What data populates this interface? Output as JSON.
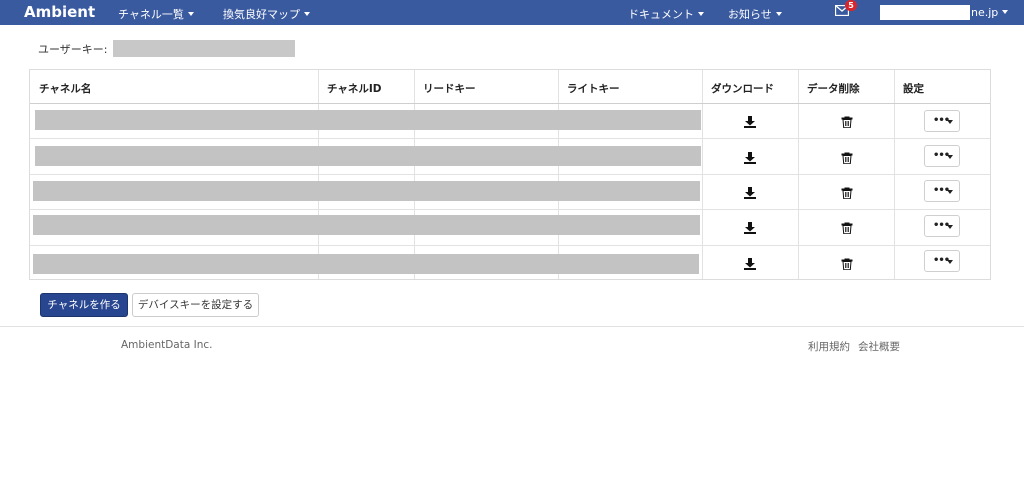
{
  "nav": {
    "brand": "Ambient",
    "menu_channels": "チャネル一覧",
    "menu_map": "換気良好マップ",
    "menu_docs": "ドキュメント",
    "menu_news": "お知らせ",
    "mail_badge": "5",
    "user_domain": "ne.jp"
  },
  "user_key": {
    "label": "ユーザーキー:"
  },
  "table": {
    "headers": [
      "チャネル名",
      "チャネルID",
      "リードキー",
      "ライトキー",
      "ダウンロード",
      "データ削除",
      "設定"
    ],
    "settings_label": "•••"
  },
  "buttons": {
    "create_channel": "チャネルを作る",
    "set_device_key": "デバイスキーを設定する"
  },
  "footer": {
    "company": "AmbientData Inc.",
    "terms": "利用規約",
    "about": "会社概要"
  }
}
